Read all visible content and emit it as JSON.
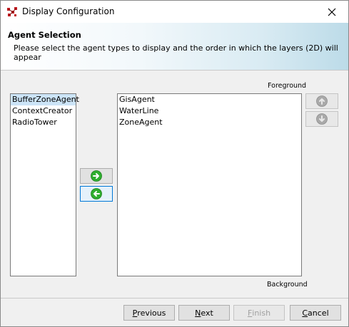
{
  "window": {
    "title": "Display Configuration"
  },
  "header": {
    "title": "Agent Selection",
    "description": "Please select the agent types to display and the order in which the layers (2D) will appear"
  },
  "labels": {
    "foreground": "Foreground",
    "background": "Background"
  },
  "available_agents": [
    {
      "label": "BufferZoneAgent",
      "selected": true
    },
    {
      "label": "ContextCreator",
      "selected": false
    },
    {
      "label": "RadioTower",
      "selected": false
    }
  ],
  "displayed_agents": [
    {
      "label": "GisAgent"
    },
    {
      "label": "WaterLine"
    },
    {
      "label": "ZoneAgent"
    }
  ],
  "move_buttons": {
    "add_icon": "arrow-right-circle-icon",
    "remove_icon": "arrow-left-circle-icon",
    "up_icon": "arrow-up-circle-icon",
    "down_icon": "arrow-down-circle-icon"
  },
  "footer": {
    "previous_mnemonic": "P",
    "previous_rest": "revious",
    "next_mnemonic": "N",
    "next_rest": "ext",
    "finish_mnemonic": "F",
    "finish_rest": "inish",
    "cancel_mnemonic": "C",
    "cancel_rest": "ancel"
  },
  "colors": {
    "green_icon": "#2fae2f",
    "disabled_icon": "#a9a9a9",
    "selection": "#cce4f7",
    "focus_border": "#0078d7"
  }
}
